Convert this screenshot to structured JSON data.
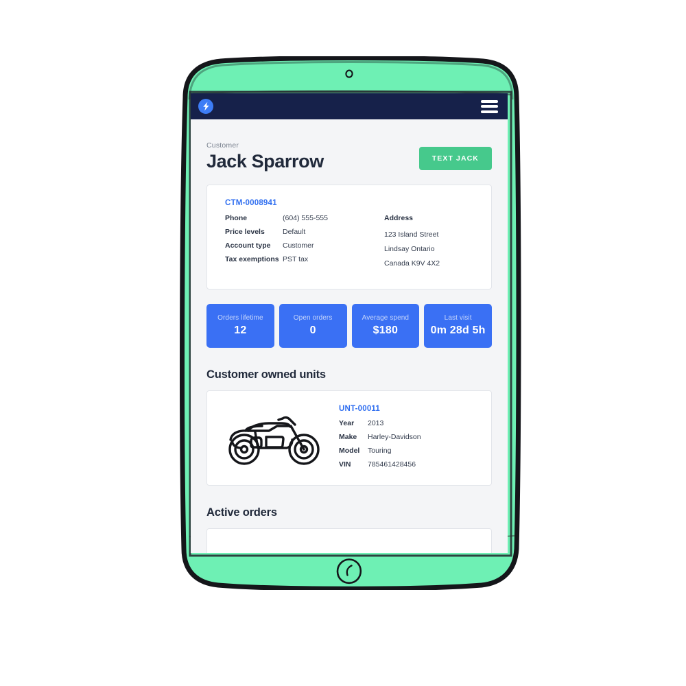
{
  "navbar": {
    "logo_icon": "lightning-bolt-logo",
    "menu_icon": "hamburger-menu-icon"
  },
  "device": {
    "frame_color": "#6ef0b4",
    "camera_icon": "front-camera",
    "home_button_icon": "home-button"
  },
  "header": {
    "eyebrow": "Customer",
    "title": "Jack Sparrow",
    "action_label": "TEXT JACK",
    "action_color": "#46c98c"
  },
  "customer_card": {
    "id": "CTM-0008941",
    "fields": [
      {
        "label": "Phone",
        "value": "(604) 555-555"
      },
      {
        "label": "Price levels",
        "value": "Default"
      },
      {
        "label": "Account type",
        "value": "Customer"
      },
      {
        "label": "Tax exemptions",
        "value": "PST tax"
      }
    ],
    "address_title": "Address",
    "address_lines": [
      "123 Island Street",
      "Lindsay Ontario",
      "Canada K9V 4X2"
    ]
  },
  "tiles": [
    {
      "label": "Orders lifetime",
      "value": "12"
    },
    {
      "label": "Open orders",
      "value": "0"
    },
    {
      "label": "Average spend",
      "value": "$180"
    },
    {
      "label": "Last visit",
      "value": "0m 28d 5h"
    }
  ],
  "tile_color": "#3a70f4",
  "units_section": {
    "title": "Customer owned units",
    "unit": {
      "id": "UNT-00011",
      "art_icon": "motorcycle-illustration",
      "fields": [
        {
          "label": "Year",
          "value": "2013"
        },
        {
          "label": "Make",
          "value": "Harley-Davidson"
        },
        {
          "label": "Model",
          "value": "Touring"
        },
        {
          "label": "VIN",
          "value": "785461428456"
        }
      ]
    }
  },
  "orders_section": {
    "title": "Active orders"
  },
  "accent_link_color": "#2f6ef0"
}
